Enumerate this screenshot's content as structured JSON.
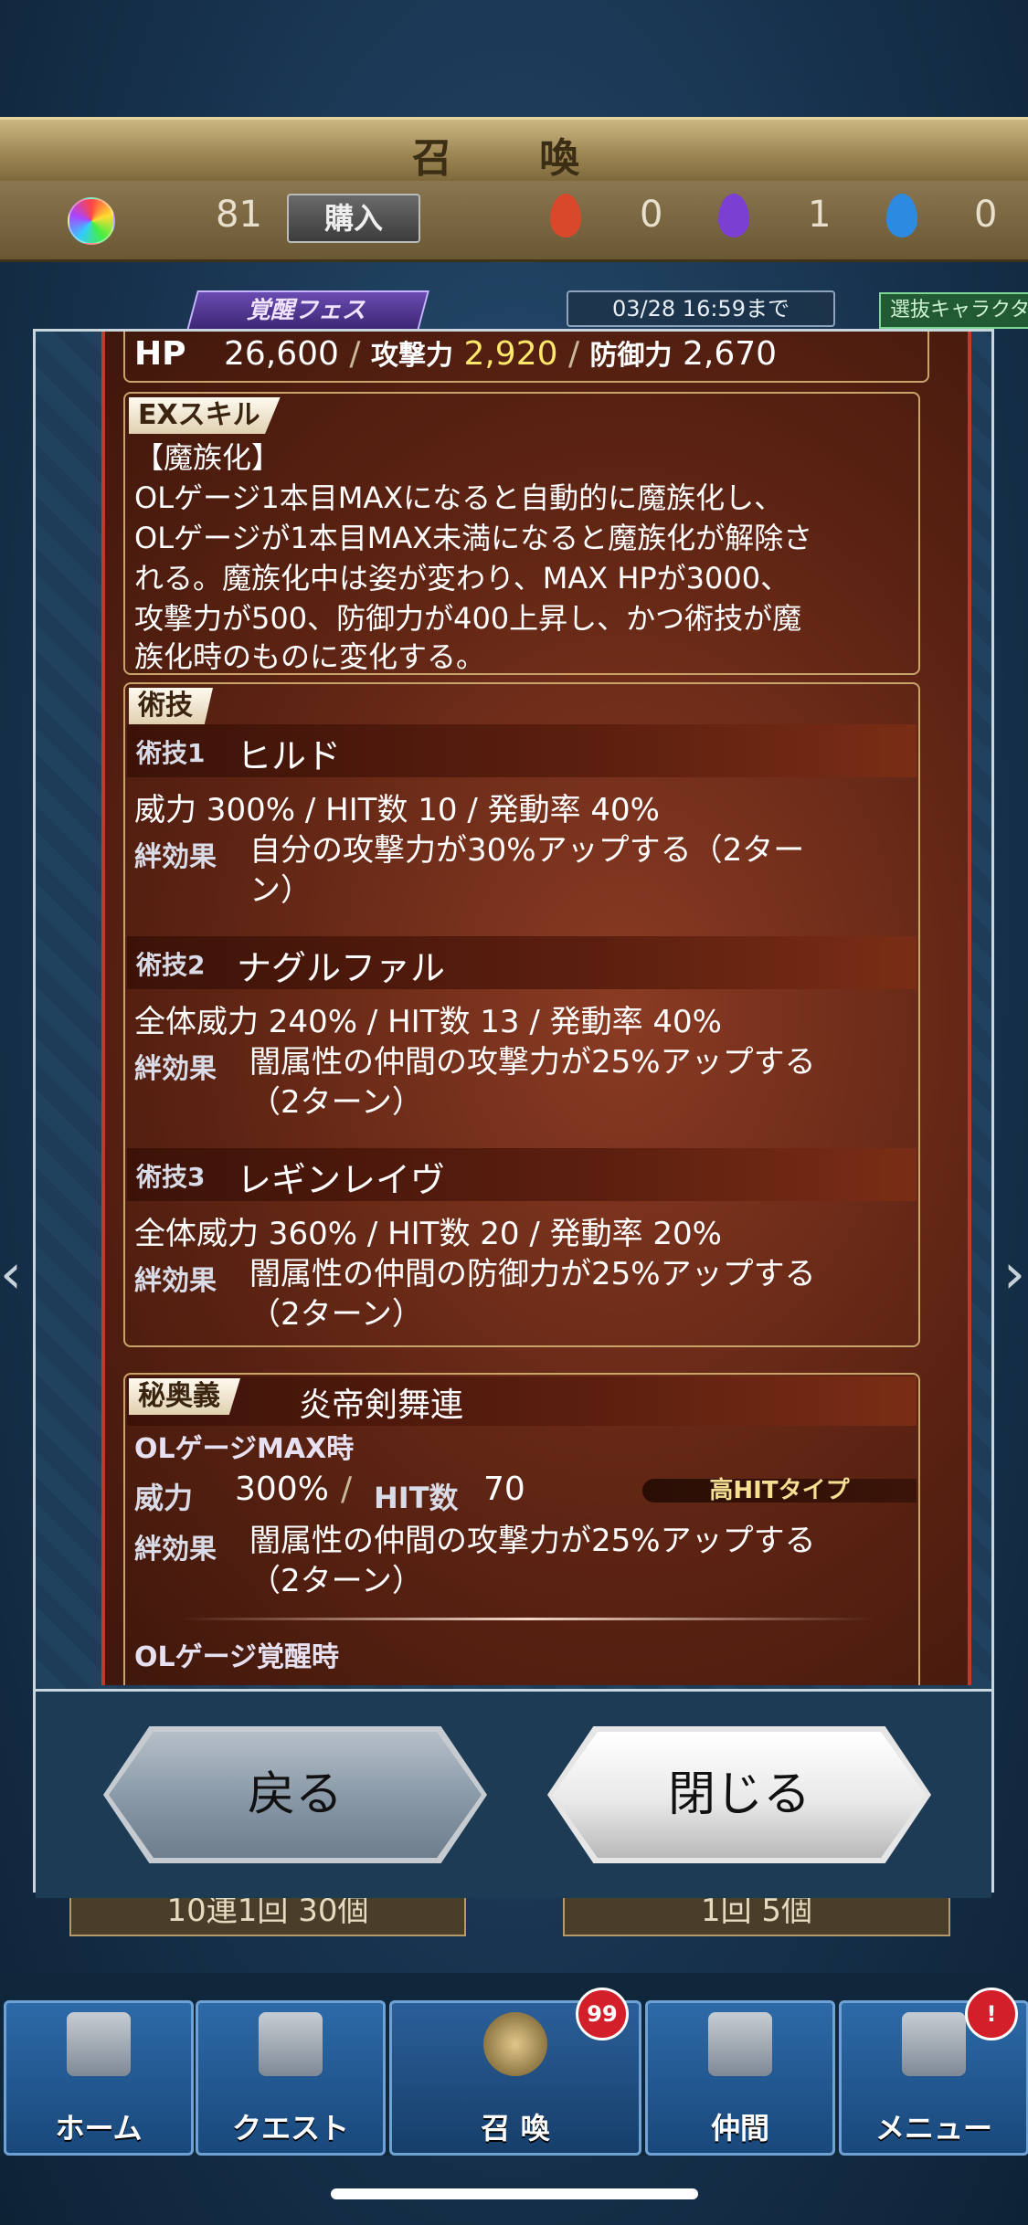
{
  "header": {
    "title": "召 喚",
    "orb_count": "81",
    "buy_label": "購入",
    "fire_count": "0",
    "purple_count": "1",
    "blue_count": "0",
    "colors": {
      "fire": "#d9482b",
      "purple": "#7b3fd1",
      "blue": "#2c8be0"
    }
  },
  "banner": {
    "fes_label": "覚醒フェス",
    "until_label": "03/28 16:59まで",
    "select_label": "選抜キャラクタ"
  },
  "stats": {
    "hp_label": "HP",
    "hp": "26,600",
    "atk_label": "攻撃力",
    "atk": "2,920",
    "def_label": "防御力",
    "def": "2,670",
    "sep": "/"
  },
  "ex_skill": {
    "tag": "EXスキル",
    "name": "【魔族化】",
    "lines": [
      "OLゲージ1本目MAXになると自動的に魔族化し、",
      "OLゲージが1本目MAX未満になると魔族化が解除さ",
      "れる。魔族化中は姿が変わり、MAX HPが3000、",
      "攻撃力が500、防御力が400上昇し、かつ術技が魔",
      "族化時のものに変化する。"
    ]
  },
  "arts": {
    "tag": "術技",
    "items": [
      {
        "label": "術技1",
        "name": "ヒルド",
        "stats": "威力 300% / HIT数 10 / 発動率 40%",
        "bond_label": "絆効果",
        "bond_line1": "自分の攻撃力が30%アップする（2ター",
        "bond_line2": "ン）"
      },
      {
        "label": "術技2",
        "name": "ナグルファル",
        "stats": "全体威力 240% / HIT数 13 / 発動率 40%",
        "bond_label": "絆効果",
        "bond_line1": "闇属性の仲間の攻撃力が25%アップする",
        "bond_line2": "（2ターン）"
      },
      {
        "label": "術技3",
        "name": "レギンレイヴ",
        "stats": "全体威力 360% / HIT数 20 / 発動率 20%",
        "bond_label": "絆効果",
        "bond_line1": "闇属性の仲間の防御力が25%アップする",
        "bond_line2": "（2ターン）"
      }
    ]
  },
  "ougi": {
    "tag": "秘奥義",
    "name": "炎帝剣舞連",
    "max_label": "OLゲージMAX時",
    "power_label": "威力",
    "power": "300%",
    "hit_label": "HIT数",
    "hit": "70",
    "type_label": "高HITタイプ",
    "bond_label": "絆効果",
    "bond_line1": "闇属性の仲間の攻撃力が25%アップする",
    "bond_line2": "（2ターン）",
    "awake_label": "OLゲージ覚醒時"
  },
  "buttons": {
    "back": "戻る",
    "close": "閉じる"
  },
  "behind": {
    "left": "10連1回 30個",
    "right": "1回 5個"
  },
  "nav": {
    "items": [
      {
        "label": "ホーム",
        "icon": "home-icon"
      },
      {
        "label": "クエスト",
        "icon": "quest-map-icon"
      },
      {
        "label": "召 喚",
        "icon": "summon-icon",
        "badge": "99"
      },
      {
        "label": "仲間",
        "icon": "ally-icon"
      },
      {
        "label": "メニュー",
        "icon": "menu-scroll-icon",
        "badge": "!"
      }
    ]
  }
}
